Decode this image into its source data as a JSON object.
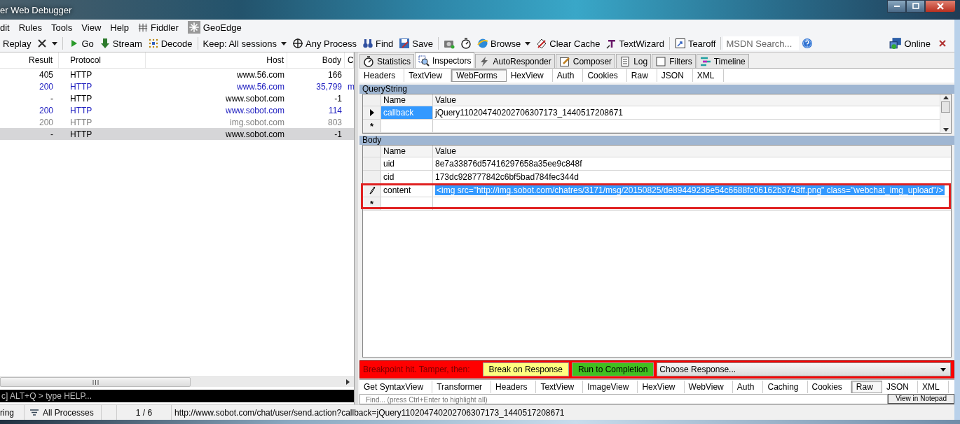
{
  "window": {
    "title": "er Web Debugger"
  },
  "menu": [
    "dit",
    "Rules",
    "Tools",
    "View",
    "Help",
    "Fiddler",
    "GeoEdge"
  ],
  "toolbar": [
    {
      "kind": "button",
      "label": "Replay"
    },
    {
      "kind": "icon-dropdown"
    },
    {
      "kind": "button",
      "label": "Go"
    },
    {
      "kind": "button",
      "label": "Stream"
    },
    {
      "kind": "button",
      "label": "Decode"
    },
    {
      "kind": "dropdown",
      "label": "Keep: All sessions"
    },
    {
      "kind": "button",
      "label": "Any Process"
    },
    {
      "kind": "button",
      "label": "Find"
    },
    {
      "kind": "button",
      "label": "Save"
    },
    {
      "kind": "icon"
    },
    {
      "kind": "icon"
    },
    {
      "kind": "dropdown",
      "label": "Browse"
    },
    {
      "kind": "button",
      "label": "Clear Cache"
    },
    {
      "kind": "button",
      "label": "TextWizard"
    },
    {
      "kind": "button",
      "label": "Tearoff"
    },
    {
      "kind": "search",
      "placeholder": "MSDN Search..."
    },
    {
      "kind": "icon"
    }
  ],
  "toolbar_right": {
    "online": "Online"
  },
  "sessions": {
    "columns": [
      "Result",
      "Protocol",
      "Host",
      "Body",
      "C"
    ],
    "rows": [
      {
        "result": "405",
        "protocol": "HTTP",
        "host": "www.56.com",
        "body": "166",
        "color": "#000000",
        "selected": false
      },
      {
        "result": "200",
        "protocol": "HTTP",
        "host": "www.56.com",
        "body": "35,799",
        "extra": "m",
        "color": "#2020c0",
        "selected": false
      },
      {
        "result": "-",
        "protocol": "HTTP",
        "host": "www.sobot.com",
        "body": "-1",
        "color": "#000000",
        "selected": false
      },
      {
        "result": "200",
        "protocol": "HTTP",
        "host": "www.sobot.com",
        "body": "114",
        "color": "#2020c0",
        "selected": false
      },
      {
        "result": "200",
        "protocol": "HTTP",
        "host": "img.sobot.com",
        "body": "803",
        "color": "#808080",
        "selected": false
      },
      {
        "result": "-",
        "protocol": "HTTP",
        "host": "www.sobot.com",
        "body": "-1",
        "color": "#000000",
        "selected": true
      }
    ]
  },
  "quickexec": {
    "placeholder": "c] ALT+Q > type HELP..."
  },
  "tabs": [
    {
      "label": "Statistics",
      "selected": false
    },
    {
      "label": "Inspectors",
      "selected": true
    },
    {
      "label": "AutoResponder",
      "selected": false
    },
    {
      "label": "Composer",
      "selected": false
    },
    {
      "label": "Log",
      "selected": false
    },
    {
      "label": "Filters",
      "selected": false
    },
    {
      "label": "Timeline",
      "selected": false
    }
  ],
  "inspector_tabs": [
    {
      "label": "Headers",
      "selected": false
    },
    {
      "label": "TextView",
      "selected": false
    },
    {
      "label": "WebForms",
      "selected": true
    },
    {
      "label": "HexView",
      "selected": false
    },
    {
      "label": "Auth",
      "selected": false
    },
    {
      "label": "Cookies",
      "selected": false
    },
    {
      "label": "Raw",
      "selected": false
    },
    {
      "label": "JSON",
      "selected": false
    },
    {
      "label": "XML",
      "selected": false
    }
  ],
  "querystring": {
    "title": "QueryString",
    "columns": [
      "Name",
      "Value"
    ],
    "new_row": "*",
    "rows": [
      {
        "name": "callback",
        "value": "jQuery110204740202706307173_1440517208671",
        "current": true,
        "selected": true
      }
    ]
  },
  "body": {
    "title": "Body",
    "columns": [
      "Name",
      "Value"
    ],
    "new_row": "*",
    "rows": [
      {
        "name": "uid",
        "value": "8e7a33876d57416297658a35ee9c848f",
        "selected": false
      },
      {
        "name": "cid",
        "value": "173dc928777842c6bf5bad784fec344d",
        "selected": false
      },
      {
        "name": "content",
        "value": "<img  src=\"http://img.sobot.com/chatres/3171/msg/20150825/de89449236e54c6688fc06162b3743ff.png\" class=\"webchat_img_upload\"/>",
        "editing": true,
        "selected": true
      }
    ]
  },
  "breakpoint": {
    "label": "Breakpoint hit. Tamper, then:",
    "buttons": [
      {
        "label": "Break on Response",
        "color": "#ffff80"
      },
      {
        "label": "Run to Completion",
        "color": "#40c020"
      }
    ],
    "response_select": "Choose Response..."
  },
  "response_tabs": [
    {
      "label": "Get SyntaxView",
      "selected": false
    },
    {
      "label": "Transformer",
      "selected": false
    },
    {
      "label": "Headers",
      "selected": false
    },
    {
      "label": "TextView",
      "selected": false
    },
    {
      "label": "ImageView",
      "selected": false
    },
    {
      "label": "HexView",
      "selected": false
    },
    {
      "label": "WebView",
      "selected": false
    },
    {
      "label": "Auth",
      "selected": false
    },
    {
      "label": "Caching",
      "selected": false
    },
    {
      "label": "Cookies",
      "selected": false
    },
    {
      "label": "Raw",
      "selected": true
    },
    {
      "label": "JSON",
      "selected": false
    },
    {
      "label": "XML",
      "selected": false
    }
  ],
  "find": {
    "placeholder": "Find... (press Ctrl+Enter to highlight all)",
    "button": "View in Notepad"
  },
  "status_bar": [
    "ring",
    "All Processes",
    "1 / 6",
    "http://www.sobot.com/chat/user/send.action?callback=jQuery110204740202706307173_1440517208671"
  ]
}
